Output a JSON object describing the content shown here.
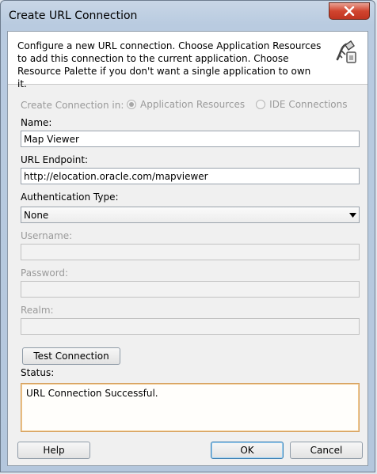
{
  "window": {
    "title": "Create URL Connection"
  },
  "header": {
    "description": "Configure a new URL connection.  Choose Application Resources to add this connection to the current application. Choose Resource Palette if you don't want a single application to own it.",
    "icon": "connection-plug-icon"
  },
  "form": {
    "create_in_label": "Create Connection in:",
    "create_in_options": [
      {
        "label": "Application Resources",
        "selected": true,
        "enabled": false
      },
      {
        "label": "IDE Connections",
        "selected": false,
        "enabled": false
      }
    ],
    "name_label": "Name:",
    "name_value": "Map Viewer",
    "url_label": "URL Endpoint:",
    "url_value": "http://elocation.oracle.com/mapviewer",
    "auth_label": "Authentication Type:",
    "auth_value": "None",
    "username_label": "Username:",
    "username_value": "",
    "password_label": "Password:",
    "password_value": "",
    "realm_label": "Realm:",
    "realm_value": ""
  },
  "test": {
    "button_label": "Test Connection",
    "status_label": "Status:",
    "status_message": "URL Connection Successful."
  },
  "footer": {
    "help_label": "Help",
    "ok_label": "OK",
    "cancel_label": "Cancel"
  },
  "colors": {
    "close_button": "#c8402c",
    "status_border": "#d6a15f",
    "titlebar": "#b9cbe0"
  }
}
